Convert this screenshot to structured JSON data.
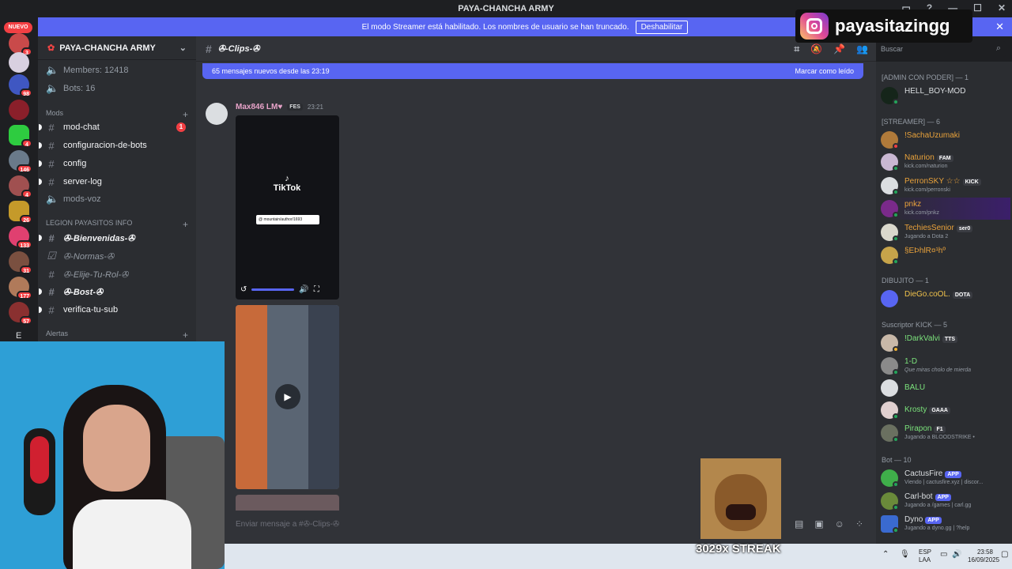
{
  "window": {
    "title": "PAYA-CHANCHA ARMY"
  },
  "banner": {
    "text": "El modo Streamer está habilitado. Los nombres de usuario se han truncado.",
    "button": "Deshabilitar"
  },
  "rail": {
    "nuevo": "NUEVO",
    "badges": [
      "3",
      "98",
      "4",
      "146",
      "4",
      "26",
      "133",
      "31",
      "177",
      "57"
    ],
    "letter": "E"
  },
  "server": {
    "name": "PAYA-CHANCHA ARMY"
  },
  "channels": {
    "top": [
      {
        "label": "Members: 12418"
      },
      {
        "label": "Bots: 16"
      }
    ],
    "mods_category": "Mods",
    "mods": [
      {
        "label": "mod-chat",
        "mention": "1"
      },
      {
        "label": "configuracion-de-bots"
      },
      {
        "label": "config"
      },
      {
        "label": "server-log"
      },
      {
        "label": "mods-voz"
      }
    ],
    "legion_category": "LEGION PAYASITOS INFO",
    "legion": [
      {
        "label": "✇-Bienvenidas-✇"
      },
      {
        "label": "✇-Normas-✇"
      },
      {
        "label": "✇-Elije-Tu-Rol-✇"
      },
      {
        "label": "✇-Bost-✇"
      },
      {
        "label": "verifica-tu-sub"
      }
    ],
    "alertas_category": "Alertas"
  },
  "chat": {
    "channel": "✇-Clips-✇",
    "new_messages": "65 mensajes nuevos desde las 23:19",
    "mark_read": "Marcar como leído",
    "author": "Max846 LM♥",
    "author_tag": "FES",
    "time": "23:21",
    "tiktok_label": "TikTok",
    "tiktok_handle": "@ mountain/author/1693",
    "input_placeholder": "Enviar mensaje a #✇-Clips-✇"
  },
  "search": {
    "placeholder": "Buscar"
  },
  "members": {
    "roles": [
      "[ADMIN CON PODER] — 1",
      "[STREAMER] — 6",
      "DIBUJITO — 1",
      "Suscriptor KICK — 5",
      "Bot — 10"
    ],
    "list": [
      {
        "name": "HELL_BOY-MOD",
        "sub": "",
        "badge": "",
        "color": "#dbdee1"
      },
      {
        "name": "!SachaUzumaki",
        "sub": "",
        "badge": "",
        "color": "#e9a23b"
      },
      {
        "name": "Naturion",
        "sub": "kick.com/naturion",
        "badge": "FAM",
        "color": "#e9a23b"
      },
      {
        "name": "PerronSKY ☆☆",
        "sub": "kick.com/perronski",
        "badge": "KICK",
        "color": "#e9a23b"
      },
      {
        "name": "pnkz",
        "sub": "kick.com/pnkz",
        "badge": "",
        "color": "#e9a23b"
      },
      {
        "name": "TechiesSenior",
        "sub": "Jugando a Dota 2",
        "badge": "ser0",
        "color": "#e9a23b"
      },
      {
        "name": "§EÞhlR¤¹hº",
        "sub": "",
        "badge": "",
        "color": "#e9a23b"
      },
      {
        "name": "DieGo.coOL.",
        "sub": "",
        "badge": "DOTA",
        "color": "#f0c24b"
      },
      {
        "name": "!DarkValvi",
        "sub": "",
        "badge": "TTS",
        "color": "#7be27b"
      },
      {
        "name": "1-D",
        "sub": "Que miras cholo de mierda",
        "badge": "",
        "color": "#7be27b"
      },
      {
        "name": "BALU",
        "sub": "",
        "badge": "",
        "color": "#7be27b"
      },
      {
        "name": "Krosty",
        "sub": "",
        "badge": "GAAA",
        "color": "#7be27b"
      },
      {
        "name": "Pirapon",
        "sub": "Jugando a BLOODSTRIKE •",
        "badge": "F1",
        "color": "#7be27b"
      },
      {
        "name": "CactusFire",
        "sub": "Viendo | cactusfire.xyz | discor...",
        "badge": "APP",
        "color": "#dbdee1"
      },
      {
        "name": "Carl-bot",
        "sub": "Jugando a /games | carl.gg",
        "badge": "APP",
        "color": "#dbdee1"
      },
      {
        "name": "Dyno",
        "sub": "Jugando a dyno.gg | ?help",
        "badge": "APP",
        "color": "#dbdee1"
      }
    ]
  },
  "overlay": {
    "instagram": "payasitazingg",
    "streak": "3029x STREAK"
  },
  "taskbar": {
    "lang1": "ESP",
    "lang2": "LAA",
    "time": "23:58",
    "date": "16/09/2025"
  }
}
